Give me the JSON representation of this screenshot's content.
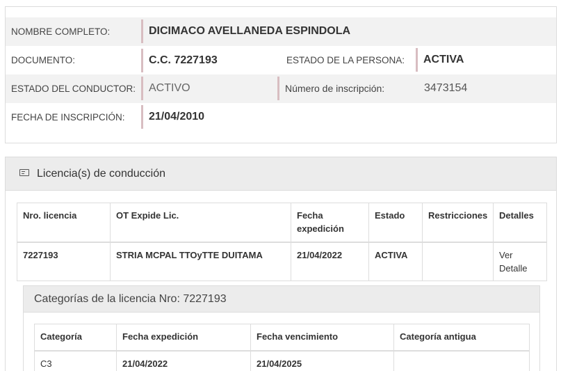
{
  "person": {
    "nombre_label": "NOMBRE COMPLETO:",
    "nombre_value": "DICIMACO AVELLANEDA ESPINDOLA",
    "documento_label": "DOCUMENTO:",
    "documento_value": "C.C. 7227193",
    "estado_persona_label": "ESTADO DE LA PERSONA:",
    "estado_persona_value": "ACTIVA",
    "estado_conductor_label": "ESTADO DEL CONDUCTOR:",
    "estado_conductor_value": "ACTIVO",
    "inscripcion_num_label": "Número de inscripción:",
    "inscripcion_num_value": "3473154",
    "fecha_inscripcion_label": "FECHA DE INSCRIPCIÓN:",
    "fecha_inscripcion_value": "21/04/2010"
  },
  "licenses": {
    "title": "Licencia(s) de conducción",
    "icon": "id-card-icon",
    "headers": [
      "Nro. licencia",
      "OT Expide Lic.",
      "Fecha expedición",
      "Estado",
      "Restricciones",
      "Detalles"
    ],
    "rows": [
      {
        "nro": "7227193",
        "ot": "STRIA MCPAL TTOyTTE DUITAMA",
        "fecha": "21/04/2022",
        "estado": "ACTIVA",
        "restricciones": "",
        "detalles": "Ver Detalle"
      }
    ]
  },
  "categories": {
    "title": "Categorías de la licencia Nro: 7227193",
    "headers": [
      "Categoría",
      "Fecha expedición",
      "Fecha vencimiento",
      "Categoría antigua"
    ],
    "rows": [
      {
        "categoria": "C3",
        "expedicion": "21/04/2022",
        "vencimiento": "21/04/2025",
        "antigua": ""
      }
    ]
  },
  "colors": {
    "value_accent_border": "#d8bdc1",
    "shade_row": "#f2f2f2",
    "panel_header": "#ececec"
  }
}
